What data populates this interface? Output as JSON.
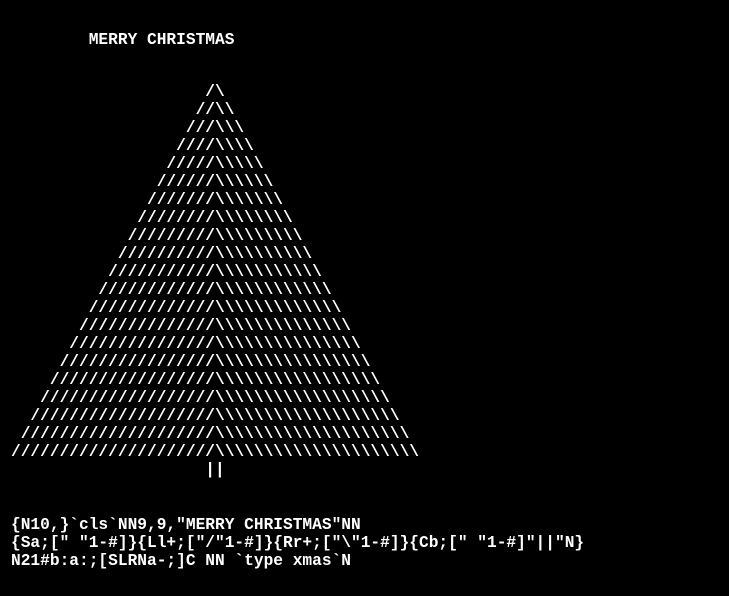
{
  "window": {
    "background": "#000000",
    "foreground": "#ffffff"
  },
  "output": {
    "title": "        MERRY CHRISTMAS",
    "tree_rows": [
      "                    /\\",
      "                   //\\\\",
      "                  ///\\\\\\",
      "                 ////\\\\\\\\",
      "                /////\\\\\\\\\\",
      "               //////\\\\\\\\\\\\",
      "              ///////\\\\\\\\\\\\\\",
      "             ////////\\\\\\\\\\\\\\\\",
      "            /////////\\\\\\\\\\\\\\\\\\",
      "           //////////\\\\\\\\\\\\\\\\\\\\",
      "          ///////////\\\\\\\\\\\\\\\\\\\\\\",
      "         ////////////\\\\\\\\\\\\\\\\\\\\\\\\",
      "        /////////////\\\\\\\\\\\\\\\\\\\\\\\\\\",
      "       //////////////\\\\\\\\\\\\\\\\\\\\\\\\\\\\",
      "      ///////////////\\\\\\\\\\\\\\\\\\\\\\\\\\\\\\",
      "     ////////////////\\\\\\\\\\\\\\\\\\\\\\\\\\\\\\\\",
      "    /////////////////\\\\\\\\\\\\\\\\\\\\\\\\\\\\\\\\\\",
      "   //////////////////\\\\\\\\\\\\\\\\\\\\\\\\\\\\\\\\\\\\",
      "  ///////////////////\\\\\\\\\\\\\\\\\\\\\\\\\\\\\\\\\\\\\\",
      " ////////////////////\\\\\\\\\\\\\\\\\\\\\\\\\\\\\\\\\\\\\\\\",
      "/////////////////////\\\\\\\\\\\\\\\\\\\\\\\\\\\\\\\\\\\\\\\\\\",
      "                    ||"
    ]
  },
  "commands": {
    "line1": "{N10,}`cls`NN9,9,\"MERRY CHRISTMAS\"NN",
    "line2": "{Sa;[\" \"1-#]}{Ll+;[\"/\"1-#]}{Rr+;[\"\\\"1-#]}{Cb;[\" \"1-#]\"||\"N}",
    "line3": "N21#b:a:;[SLRNa-;]C NN `type xmas`N"
  }
}
